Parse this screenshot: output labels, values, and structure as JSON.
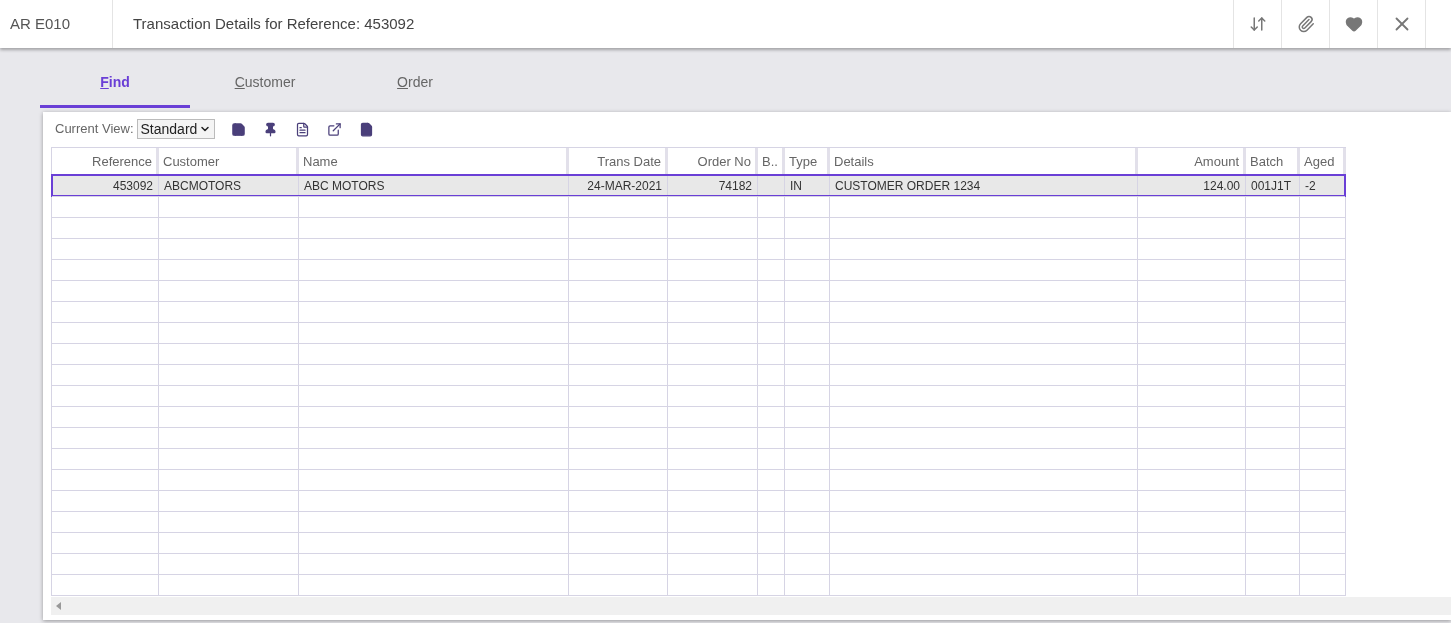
{
  "header": {
    "code": "AR E010",
    "title": "Transaction Details for Reference: 453092"
  },
  "tabs": [
    {
      "label": "Find",
      "selected": true
    },
    {
      "label": "Customer",
      "selected": false
    },
    {
      "label": "Order",
      "selected": false
    }
  ],
  "toolbar": {
    "label": "Current View:",
    "view": "Standard"
  },
  "table": {
    "columns": [
      {
        "label": "Reference",
        "kind": "number"
      },
      {
        "label": "Customer",
        "kind": "text"
      },
      {
        "label": "Name",
        "kind": "text"
      },
      {
        "label": "Trans Date",
        "kind": "number"
      },
      {
        "label": "Order No",
        "kind": "number"
      },
      {
        "label": "B..",
        "kind": "text"
      },
      {
        "label": "Type",
        "kind": "text"
      },
      {
        "label": "Details",
        "kind": "text"
      },
      {
        "label": "Amount",
        "kind": "number"
      },
      {
        "label": "Batch",
        "kind": "text"
      },
      {
        "label": "Aged",
        "kind": "text"
      }
    ],
    "rows": [
      {
        "selected": true,
        "cells": [
          "453092",
          "ABCMOTORS",
          "ABC MOTORS",
          "24-MAR-2021",
          "74182",
          "",
          "IN",
          "CUSTOMER ORDER 1234",
          "124.00",
          "001J1T",
          "-2"
        ]
      }
    ]
  }
}
